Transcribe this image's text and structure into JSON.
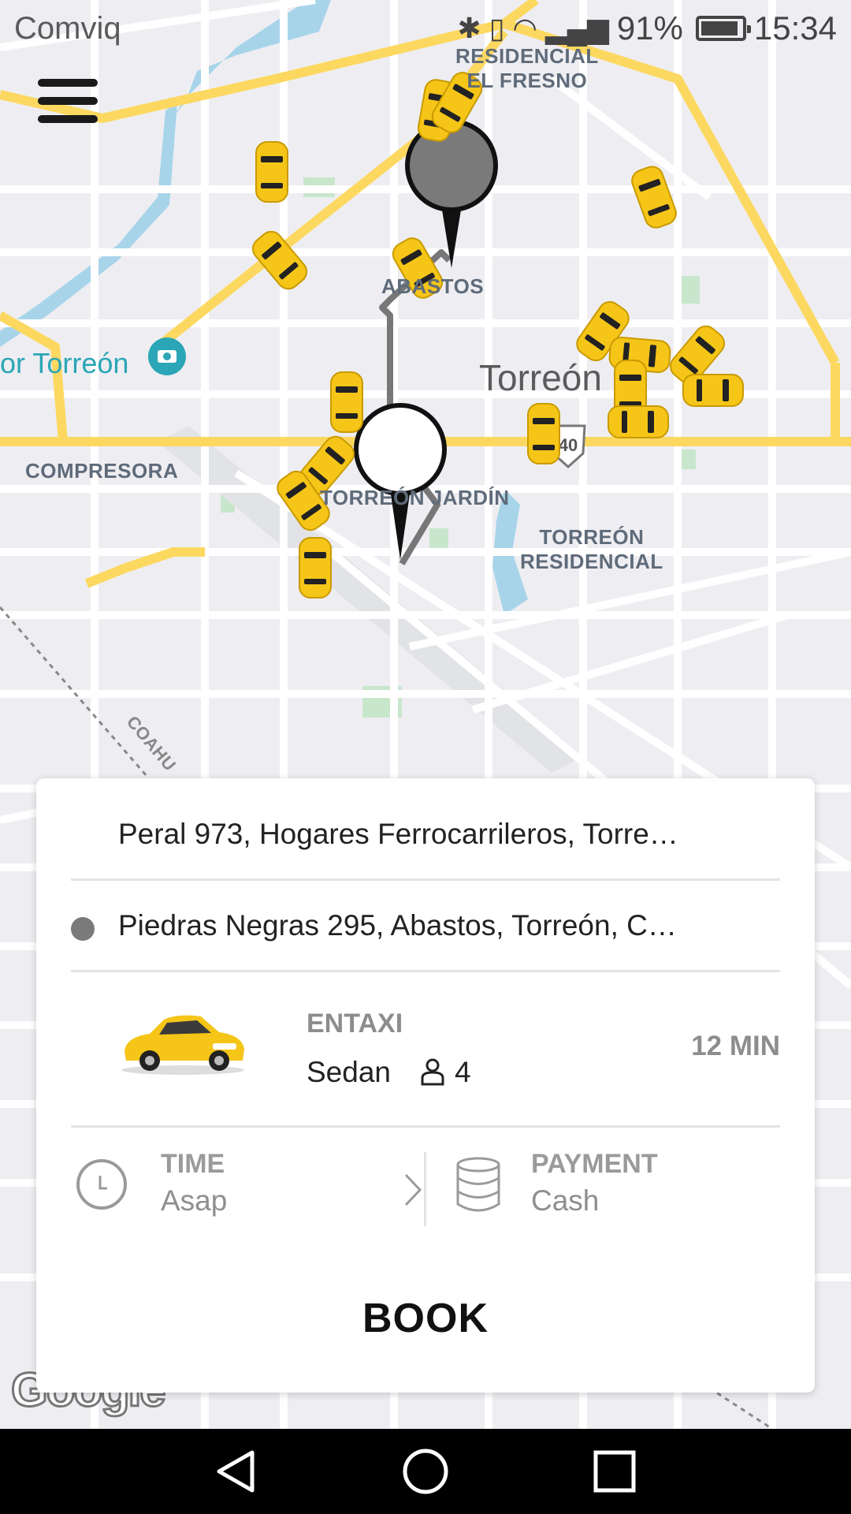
{
  "status_bar": {
    "carrier": "Comviq",
    "battery": "91%",
    "time": "15:34"
  },
  "map": {
    "neighborhoods": [
      "RESIDENCIAL\nEL FRESNO",
      "ABASTOS",
      "COMPRESORA",
      "TORREÓN JARDÍN",
      "TORREÓN\nRESIDENCIAL"
    ],
    "city": "Torreón",
    "poi": "or Torreón",
    "highway_shield": "40",
    "road_label": "COAHU",
    "attribution": "Google"
  },
  "booking": {
    "pickup_address": "Peral 973, Hogares Ferrocarrileros, Torre…",
    "dropoff_address": "Piedras Negras 295, Abastos, Torreón, C…",
    "service": {
      "name": "ENTAXI",
      "type": "Sedan",
      "seats": "4",
      "eta": "12 MIN"
    },
    "time": {
      "label": "TIME",
      "value": "Asap"
    },
    "payment": {
      "label": "PAYMENT",
      "value": "Cash"
    },
    "book_label": "BOOK"
  },
  "colors": {
    "taxi_yellow": "#f5c518",
    "road_yellow": "#fcd860",
    "water": "#a8d4ea",
    "park": "#c8e6cc"
  }
}
